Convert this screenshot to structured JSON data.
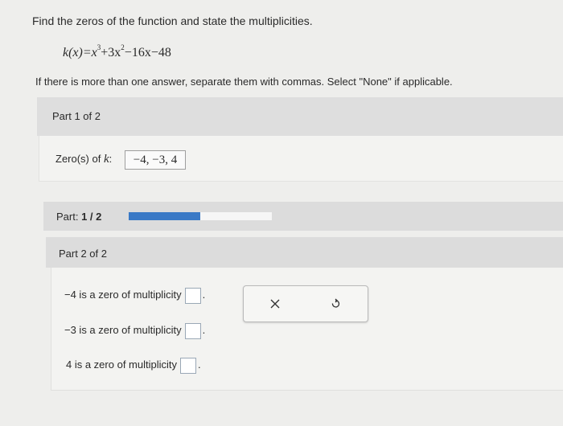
{
  "question": {
    "prompt": "Find the zeros of the function and state the multiplicities.",
    "formula_prefix": "k(x)=x",
    "formula_exp1": "3",
    "formula_mid": "+3x",
    "formula_exp2": "2",
    "formula_suffix": "−16x−48",
    "instructions": "If there is more than one answer, separate them with commas. Select \"None\" if applicable."
  },
  "part1": {
    "header": "Part 1 of 2",
    "zeros_label_prefix": "Zero(s) of ",
    "zeros_label_var": "k",
    "zeros_label_suffix": ":",
    "zeros_value": "−4, −3, 4"
  },
  "progress": {
    "label": "Part:",
    "value_text": "1 / 2",
    "fraction": 0.5,
    "color": "#3a79c6"
  },
  "part2": {
    "header": "Part 2 of 2",
    "rows": [
      {
        "text": "−4 is a zero of multiplicity",
        "suffix": "."
      },
      {
        "text": "−3 is a zero of multiplicity",
        "suffix": "."
      },
      {
        "text": "4 is a zero of multiplicity",
        "suffix": "."
      }
    ]
  },
  "actions": {
    "clear_icon": "close-icon",
    "undo_icon": "undo-icon"
  }
}
